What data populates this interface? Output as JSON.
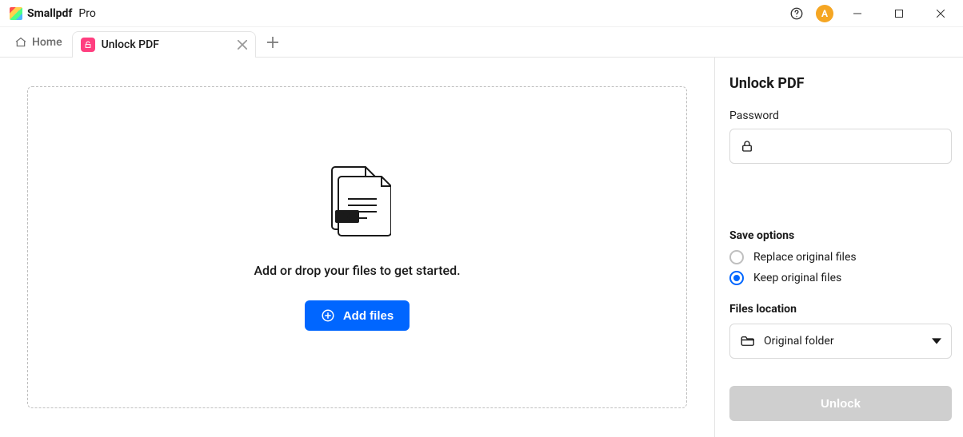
{
  "titlebar": {
    "brand_name": "Smallpdf",
    "brand_suffix": "Pro",
    "avatar_initial": "A"
  },
  "tabbar": {
    "home_label": "Home",
    "tab_label": "Unlock PDF"
  },
  "dropzone": {
    "prompt": "Add or drop your files to get started.",
    "add_button": "Add files"
  },
  "sidebar": {
    "title": "Unlock PDF",
    "password_label": "Password",
    "password_value": "",
    "save_options_title": "Save options",
    "option_replace": "Replace original files",
    "option_keep": "Keep original files",
    "location_title": "Files location",
    "location_value": "Original folder",
    "unlock_button": "Unlock"
  }
}
